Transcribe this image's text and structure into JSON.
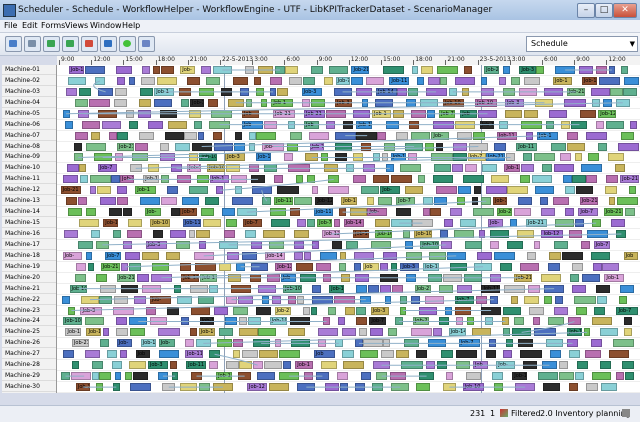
{
  "window": {
    "title": "Scheduler - Schedule - WorkflowHelper - WorkflowEngine - UTF - LibKPITrackerDataset - ScenarioManager"
  },
  "menu": [
    "File",
    "Edit",
    "Forms",
    "Views",
    "Window",
    "Help"
  ],
  "toolbar": {
    "buttons": [
      "open-icon",
      "refresh-icon",
      "upload-icon",
      "download-icon",
      "add-icon",
      "cut-icon",
      "smiley-icon",
      "properties-icon"
    ],
    "view_select": "Schedule"
  },
  "timeaxis": [
    "9:00",
    "12:00",
    "15:00",
    "18:00",
    "21:00",
    "22-5-2013",
    "3:00",
    "6:00",
    "9:00",
    "12:00",
    "15:00",
    "18:00",
    "21:00",
    "23-5-2013",
    "3:00",
    "6:00",
    "9:00",
    "12:00"
  ],
  "machines": [
    "Machine-01",
    "Machine-02",
    "Machine-03",
    "Machine-04",
    "Machine-05",
    "Machine-06",
    "Machine-07",
    "Machine-08",
    "Machine-09",
    "Machine-10",
    "Machine-11",
    "Machine-12",
    "Machine-13",
    "Machine-14",
    "Machine-15",
    "Machine-16",
    "Machine-17",
    "Machine-18",
    "Machine-19",
    "Machine-20",
    "Machine-21",
    "Machine-22",
    "Machine-23",
    "Machine-24",
    "Machine-25",
    "Machine-26",
    "Machine-27",
    "Machine-28",
    "Machine-29",
    "Machine-30"
  ],
  "job_labels": [
    "Job",
    "Job-",
    "Job-1",
    "Job-10",
    "Job-11",
    "Job-12",
    "Job-14",
    "Job-21",
    "Job-3",
    "Job-7"
  ],
  "palette": [
    "#6bbf59",
    "#9b6bd1",
    "#3a8fd8",
    "#2b2b2b",
    "#d9a3d9",
    "#8ad0d6",
    "#c8b45c",
    "#5fb08f",
    "#a97bd6",
    "#4c6fbf",
    "#e0d47a",
    "#7dc08a",
    "#b86fb0",
    "#2f8f6f",
    "#c9c9c9",
    "#8c4f2f"
  ],
  "statusbar": {
    "count": "231",
    "count2": "1",
    "filtered": "Filtered",
    "mode": "2.0 Inventory planning"
  }
}
